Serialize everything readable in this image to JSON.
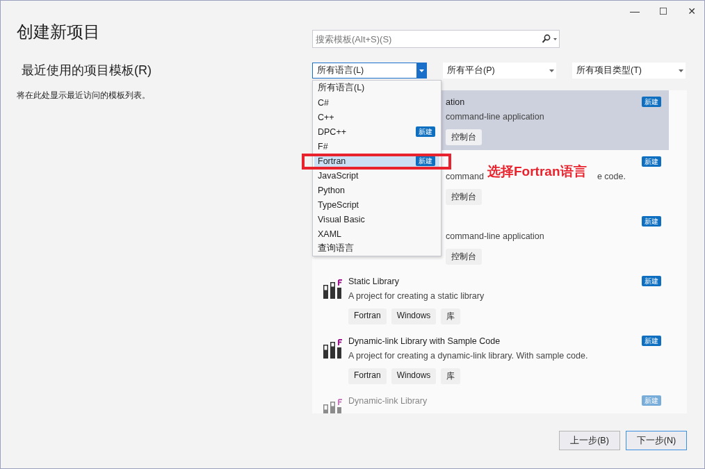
{
  "window": {
    "controls": [
      "—",
      "☐",
      "✕"
    ]
  },
  "title": "创建新项目",
  "recent": {
    "heading": "最近使用的项目模板(R)",
    "empty_text": "将在此处显示最近访问的模板列表。"
  },
  "search": {
    "placeholder": "搜索模板(Alt+S)(S)"
  },
  "filters": [
    {
      "value": "所有语言(L)",
      "expanded": true
    },
    {
      "value": "所有平台(P)",
      "expanded": false
    },
    {
      "value": "所有项目类型(T)",
      "expanded": false
    }
  ],
  "language_menu": [
    {
      "label": "所有语言(L)",
      "selected": false
    },
    {
      "label": "C#",
      "selected": false
    },
    {
      "label": "C++",
      "selected": false
    },
    {
      "label": "DPC++",
      "selected": false,
      "badge": "新建"
    },
    {
      "label": "F#",
      "selected": false
    },
    {
      "label": "Fortran",
      "selected": true,
      "badge": "新建"
    },
    {
      "label": "JavaScript",
      "selected": false
    },
    {
      "label": "Python",
      "selected": false
    },
    {
      "label": "TypeScript",
      "selected": false
    },
    {
      "label": "Visual Basic",
      "selected": false
    },
    {
      "label": "XAML",
      "selected": false
    },
    {
      "label": "查询语言",
      "selected": false
    }
  ],
  "templates": [
    {
      "kind": "covered",
      "title": "ation",
      "description": "command-line application",
      "tags": [
        "控制台"
      ],
      "badge": "新建",
      "selected": true,
      "faded": false
    },
    {
      "kind": "covered",
      "description_parts": [
        "command",
        "e code."
      ],
      "tags": [
        "控制台"
      ],
      "badge": "新建",
      "selected": false,
      "faded": false
    },
    {
      "kind": "covered",
      "description": "command-line application",
      "tags": [
        "控制台"
      ],
      "badge": "新建",
      "selected": false,
      "faded": false
    },
    {
      "kind": "full",
      "title": "Static Library",
      "description": "A project for creating a static library",
      "tags": [
        "Fortran",
        "Windows",
        "库"
      ],
      "badge": "新建",
      "selected": false,
      "faded": false
    },
    {
      "kind": "full",
      "title": "Dynamic-link Library with Sample Code",
      "description": "A project for creating a dynamic-link library. With sample code.",
      "tags": [
        "Fortran",
        "Windows",
        "库"
      ],
      "badge": "新建",
      "selected": false,
      "faded": false
    },
    {
      "kind": "full",
      "title": "Dynamic-link Library",
      "badge": "新建",
      "selected": false,
      "faded": true
    }
  ],
  "annotation": {
    "text": "选择Fortran语言"
  },
  "buttons": [
    {
      "label": "上一步(B)",
      "primary": false
    },
    {
      "label": "下一步(N)",
      "primary": true
    }
  ]
}
